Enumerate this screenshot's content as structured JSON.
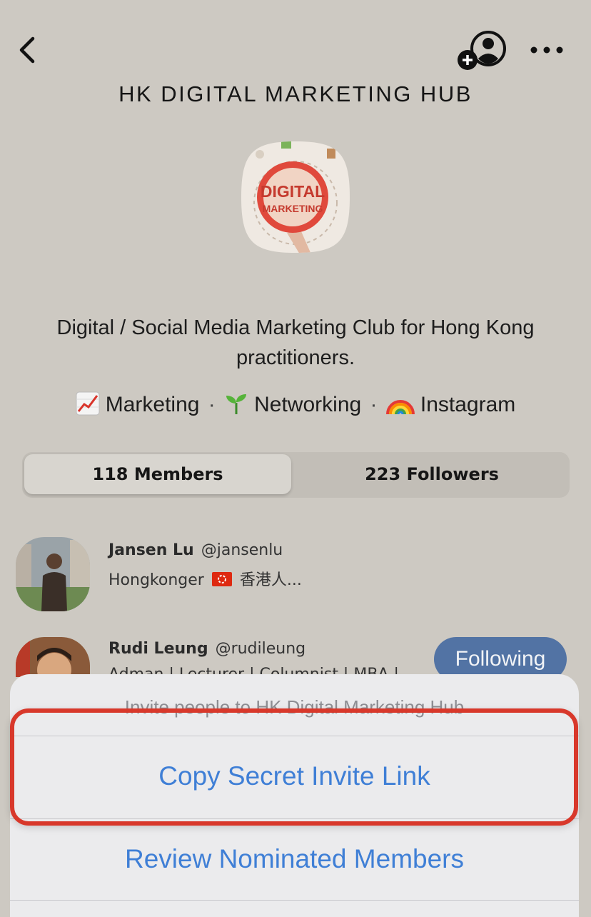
{
  "header": {
    "title": "HK DIGITAL MARKETING HUB"
  },
  "logo": {
    "line1": "DIGITAL",
    "line2": "MARKETING"
  },
  "description": "Digital / Social Media Marketing Club for Hong Kong practitioners.",
  "topics": [
    {
      "icon": "chart-increasing-icon",
      "label": "Marketing"
    },
    {
      "icon": "seedling-icon",
      "label": "Networking"
    },
    {
      "icon": "rainbow-icon",
      "label": "Instagram"
    }
  ],
  "topic_separator": "·",
  "tabs": {
    "members": "118 Members",
    "followers": "223 Followers"
  },
  "members": [
    {
      "name": "Jansen Lu",
      "handle": "@jansenlu",
      "bio_prefix": "Hongkonger",
      "bio_suffix": "香港人...",
      "flag": "hong-kong-flag-icon"
    },
    {
      "name": "Rudi Leung",
      "handle": "@rudileung",
      "bio": "Adman | Lecturer | Columnist | MBA |",
      "button": "Following"
    }
  ],
  "sheet": {
    "title": "Invite people to HK Digital Marketing Hub",
    "actions": [
      "Copy Secret Invite Link",
      "Review Nominated Members"
    ]
  },
  "colors": {
    "background": "#cdc9c2",
    "accent_blue": "#3f7fd6",
    "following_button": "#5273a4",
    "highlight_red": "#d8382b"
  }
}
